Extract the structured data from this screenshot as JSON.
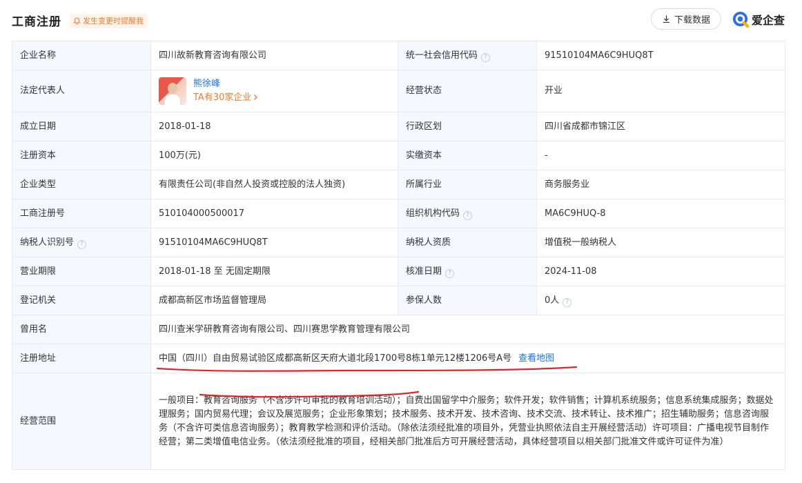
{
  "header": {
    "title": "工商注册",
    "remind_label": "发生变更时提醒我",
    "download_label": "下载数据",
    "brand": "爱企查"
  },
  "colors": {
    "accent": "#1a73e8",
    "orange": "#f07b2c",
    "label_bg": "#f5f8fd",
    "annotation": "#e0232a"
  },
  "rows": [
    {
      "l1": "企业名称",
      "v1": "四川故新教育咨询有限公司",
      "l2": "统一社会信用代码",
      "v2": "91510104MA6C9HUQ8T"
    },
    {
      "l1": "法定代表人",
      "rep_name": "熊徐峰",
      "rep_sub": "TA有30家企业",
      "l2": "经营状态",
      "v2": "开业"
    },
    {
      "l1": "成立日期",
      "v1": "2018-01-18",
      "l2": "行政区划",
      "v2": "四川省成都市锦江区"
    },
    {
      "l1": "注册资本",
      "v1": "100万(元)",
      "l2": "实缴资本",
      "v2": "-"
    },
    {
      "l1": "企业类型",
      "v1": "有限责任公司(非自然人投资或控股的法人独资)",
      "l2": "所属行业",
      "v2": "商务服务业"
    },
    {
      "l1": "工商注册号",
      "v1": "510104000500017",
      "l2": "组织机构代码",
      "v2": "MA6C9HUQ-8"
    },
    {
      "l1": "纳税人识别号",
      "v1": "91510104MA6C9HUQ8T",
      "l2": "纳税人资质",
      "v2": "增值税一般纳税人"
    },
    {
      "l1": "营业期限",
      "v1": "2018-01-18 至 无固定期限",
      "l2": "核准日期",
      "v2": "2024-11-08"
    },
    {
      "l1": "登记机关",
      "v1": "成都高新区市场监督管理局",
      "l2": "参保人数",
      "v2": "0人"
    }
  ],
  "former_name": {
    "label": "曾用名",
    "value": "四川查米学研教育咨询有限公司、四川赛思学教育管理有限公司"
  },
  "address": {
    "label": "注册地址",
    "value": "中国（四川）自由贸易试验区成都高新区天府大道北段1700号8栋1单元12楼1206号A号",
    "map_link": "查看地图"
  },
  "scope": {
    "label": "经营范围",
    "value": "一般项目：教育咨询服务（不含涉许可审批的教育培训活动）；自费出国留学中介服务；软件开发；软件销售；计算机系统服务；信息系统集成服务；数据处理服务；国内贸易代理；会议及展览服务；企业形象策划；技术服务、技术开发、技术咨询、技术交流、技术转让、技术推广；招生辅助服务；信息咨询服务（不含许可类信息咨询服务）；教育教学检测和评价活动。（除依法须经批准的项目外，凭营业执照依法自主开展经营活动）许可项目：广播电视节目制作经营；第二类增值电信业务。（依法须经批准的项目，经相关部门批准后方可开展经营活动，具体经营项目以相关部门批准文件或许可证件为准）"
  }
}
